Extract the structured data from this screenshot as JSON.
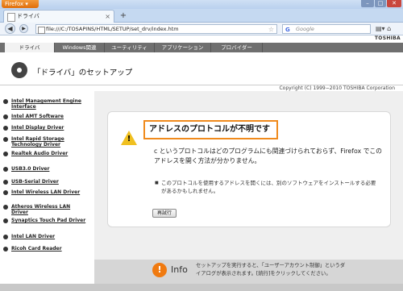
{
  "browser": {
    "app_button": "Firefox",
    "tab_title": "ドライバ",
    "new_tab": "+",
    "url": "file:///C:/TOSAPINS/HTML/SETUP/set_drv/index.htm",
    "search_placeholder": "Google",
    "search_engine_glyph": "G"
  },
  "site": {
    "brand": "TOSHIBA",
    "nav_tabs": [
      {
        "label": "ドライバ"
      },
      {
        "label": "Windows関連"
      },
      {
        "label": "ユーティリティ"
      },
      {
        "label": "アプリケーション"
      },
      {
        "label": "プロバイダー"
      }
    ],
    "page_title": "「ドライバ」のセットアップ",
    "copyright": "Copyright (C) 1999−2010 TOSHIBA Corporation"
  },
  "sidebar": {
    "items": [
      {
        "label": "Intel Management Engine Interface"
      },
      {
        "label": "Intel AMT Software"
      },
      {
        "label": "Intel Display Driver"
      },
      {
        "label": "Intel Rapid Storage Technology Driver"
      },
      {
        "label": "Realtek Audio Driver"
      },
      {
        "label": "USB3.0 Driver"
      },
      {
        "label": "USB-Serial Driver"
      },
      {
        "label": "Intel Wireless LAN Driver"
      },
      {
        "label": "Atheros Wireless LAN Driver"
      },
      {
        "label": "Synaptics Touch Pad Driver"
      },
      {
        "label": "Intel LAN Driver"
      },
      {
        "label": "Ricoh Card Reader"
      }
    ]
  },
  "error": {
    "title": "アドレスのプロトコルが不明です",
    "description": "c というプロトコルはどのプログラムにも関連づけられておらず、Firefox でこのアドレスを開く方法が分かりません。",
    "bullet": "このプロトコルを使用するアドレスを開くには、別のソフトウェアをインストールする必要があるかもしれません。",
    "retry_button": "再試行"
  },
  "info": {
    "icon_glyph": "!",
    "label": "Info",
    "text": "セットアップを実行すると、「ユーザーアカウント制御」というダイアログが表示されます。[続行]をクリックしてください。"
  },
  "colors": {
    "accent_orange": "#f08a1c",
    "warning_yellow": "#f0c020",
    "nav_gray": "#6f6f6f"
  }
}
